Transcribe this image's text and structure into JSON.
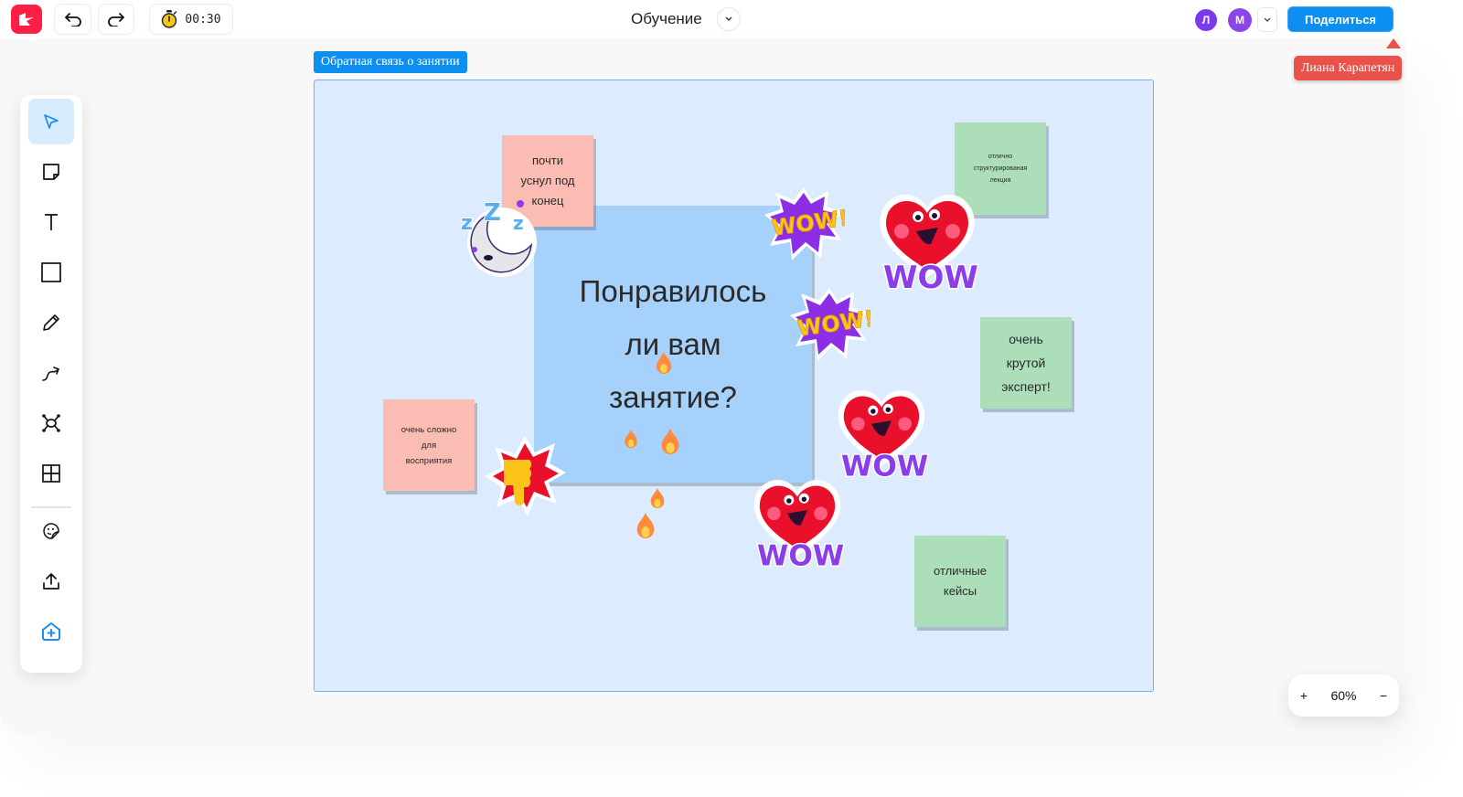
{
  "header": {
    "logo": "app-logo",
    "undo_icon": "undo-icon",
    "redo_icon": "redo-icon",
    "timer": {
      "icon": "stopwatch-icon",
      "value": "00:30"
    },
    "board_title": "Обучение",
    "title_menu_icon": "chevron-down-icon",
    "collaborators": [
      {
        "initial": "Л",
        "color": "#7c3aed"
      },
      {
        "initial": "М",
        "color": "#8b45e8"
      }
    ],
    "collaborators_more_icon": "chevron-down-icon",
    "share_label": "Поделиться",
    "accent_color": "#0d8ff2"
  },
  "toolbar": {
    "tools": [
      {
        "name": "select",
        "icon": "cursor-arrow-icon",
        "active": true
      },
      {
        "name": "sticky-note",
        "icon": "sticky-note-icon",
        "active": false
      },
      {
        "name": "text",
        "icon": "text-icon",
        "active": false
      },
      {
        "name": "shape",
        "icon": "rectangle-icon",
        "active": false
      },
      {
        "name": "pen",
        "icon": "pencil-icon",
        "active": false
      },
      {
        "name": "connector",
        "icon": "connector-arrow-icon",
        "active": false
      },
      {
        "name": "mind-map",
        "icon": "mind-map-icon",
        "active": false
      },
      {
        "name": "table",
        "icon": "table-grid-icon",
        "active": false
      },
      {
        "name": "stickers",
        "icon": "sticker-icon",
        "active": false
      },
      {
        "name": "upload",
        "icon": "upload-icon",
        "active": false
      },
      {
        "name": "add-template",
        "icon": "add-template-icon",
        "active": false
      }
    ]
  },
  "frame": {
    "label": "Обратная связь о занятии",
    "central_card": {
      "lines": [
        "Понравилось",
        "ли вам",
        "занятие?"
      ]
    },
    "stickies": [
      {
        "color": "pink",
        "lines": [
          "почти",
          "уснул под",
          "конец"
        ]
      },
      {
        "color": "pink",
        "lines": [
          "очень сложно",
          "для",
          "восприятия"
        ]
      },
      {
        "color": "green",
        "lines": [
          "отлично",
          "структурированая",
          "лекция"
        ]
      },
      {
        "color": "green",
        "lines": [
          "очень",
          "крутой",
          "эксперт!"
        ]
      },
      {
        "color": "green",
        "lines": [
          "отличные",
          "кейсы"
        ]
      }
    ],
    "stickers": [
      "sleepy-moon-sticker",
      "thumbs-down-sticker",
      "wow-burst-sticker",
      "wow-burst-sticker",
      "wow-heart-sticker",
      "wow-heart-sticker",
      "wow-heart-sticker",
      "fire-reaction",
      "fire-reaction",
      "fire-reaction",
      "fire-reaction",
      "fire-reaction"
    ]
  },
  "cursor": {
    "user_name": "Лиана Карапетян",
    "color": "#e8524a"
  },
  "zoom": {
    "plus": "+",
    "value": "60%",
    "minus": "−"
  }
}
